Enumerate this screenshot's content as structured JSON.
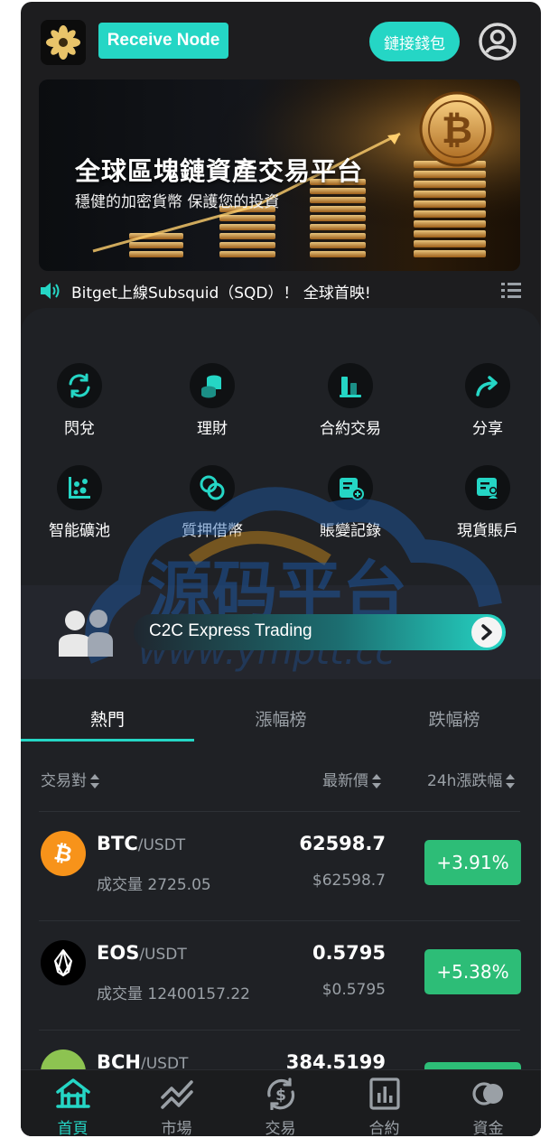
{
  "header": {
    "receive_node": "Receive Node",
    "connect_wallet": "鏈接錢包"
  },
  "banner": {
    "title": "全球區塊鏈資產交易平台",
    "subtitle": "穩健的加密貨幣 保護您的投資"
  },
  "notice": {
    "text": "Bitget上線Subsquid（SQD）！ 全球首映!"
  },
  "features": [
    {
      "label": "閃兌",
      "icon": "swap-icon"
    },
    {
      "label": "理財",
      "icon": "coins-icon"
    },
    {
      "label": "合約交易",
      "icon": "contract-chart-icon"
    },
    {
      "label": "分享",
      "icon": "share-icon"
    },
    {
      "label": "智能礦池",
      "icon": "mining-pool-icon"
    },
    {
      "label": "質押借幣",
      "icon": "pledge-icon"
    },
    {
      "label": "賬變記錄",
      "icon": "records-icon"
    },
    {
      "label": "現貨賬戶",
      "icon": "spot-account-icon"
    }
  ],
  "c2c": {
    "label": "C2C Express Trading"
  },
  "watermark": {
    "title": "源码平台",
    "url": "www.ymptt.cc"
  },
  "tabs": [
    "熱門",
    "漲幅榜",
    "跌幅榜"
  ],
  "columns": {
    "pair": "交易對",
    "price": "最新價",
    "change": "24h漲跌幅"
  },
  "market": [
    {
      "base": "BTC",
      "quote": "/USDT",
      "volume": "成交量 2725.05",
      "price": "62598.7",
      "price_usd": "$62598.7",
      "change": "+3.91%",
      "icon": "bitcoin-icon",
      "color": "#f7931a"
    },
    {
      "base": "EOS",
      "quote": "/USDT",
      "volume": "成交量 12400157.22",
      "price": "0.5795",
      "price_usd": "$0.5795",
      "change": "+5.38%",
      "icon": "eos-icon",
      "color": "#000000"
    },
    {
      "base": "BCH",
      "quote": "/USDT",
      "volume": "",
      "price": "384.5199",
      "price_usd": "",
      "change": "",
      "icon": "bitcoin-cash-icon",
      "color": "#8dc351"
    }
  ],
  "nav": [
    {
      "label": "首頁",
      "icon": "home-icon",
      "active": true
    },
    {
      "label": "市場",
      "icon": "market-trend-icon",
      "active": false
    },
    {
      "label": "交易",
      "icon": "trade-dollar-icon",
      "active": false
    },
    {
      "label": "合約",
      "icon": "contract-icon",
      "active": false
    },
    {
      "label": "資金",
      "icon": "funds-icon",
      "active": false
    }
  ],
  "colors": {
    "accent": "#25d6c5",
    "up": "#2dbd77",
    "background": "#1d1d1f"
  }
}
